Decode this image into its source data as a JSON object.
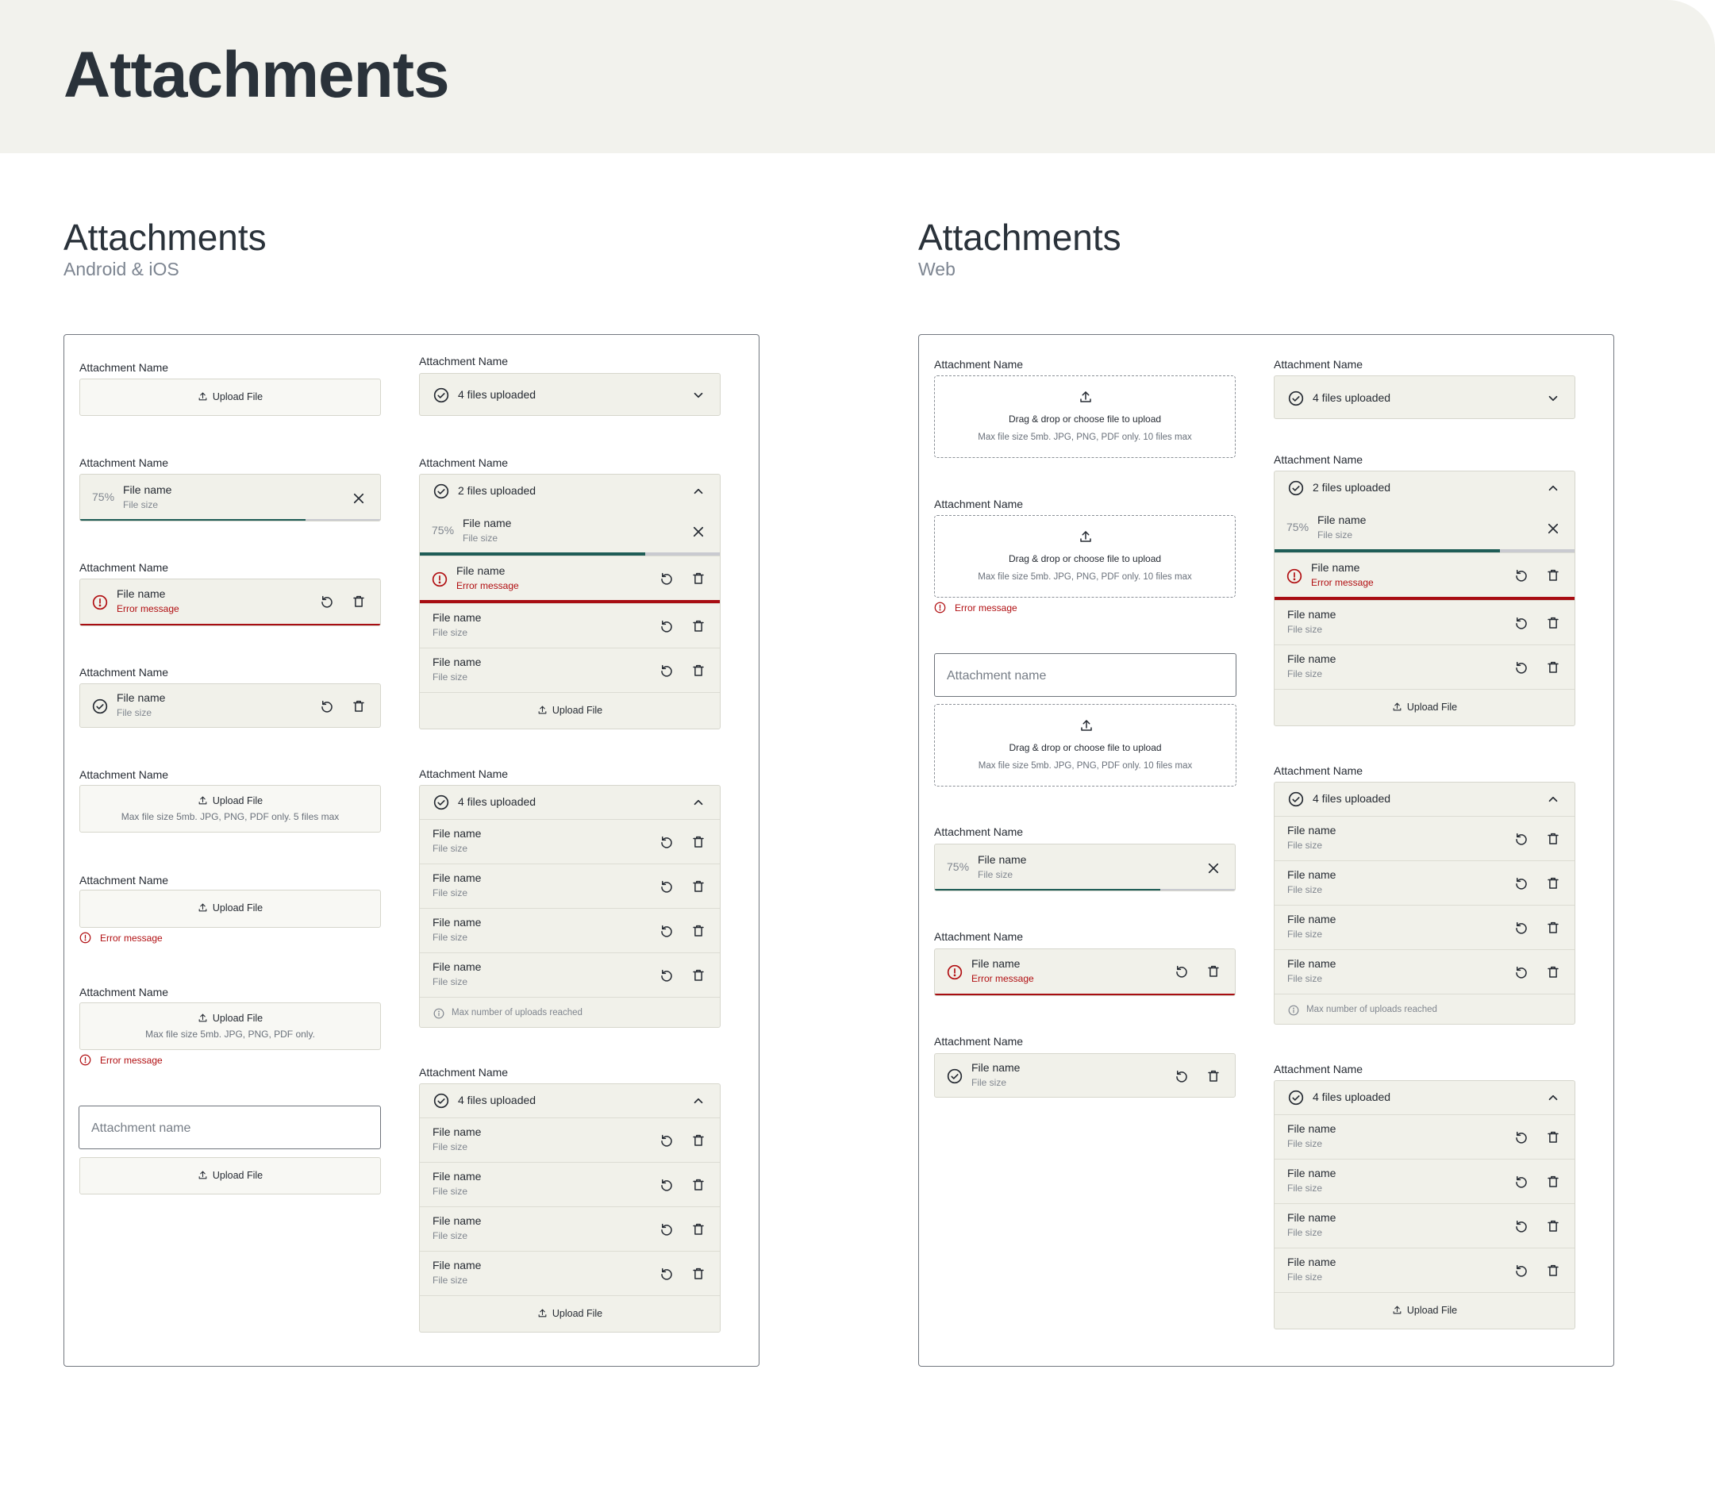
{
  "page": {
    "title": "Attachments"
  },
  "sections": {
    "mobile": {
      "title": "Attachments",
      "subtitle": "Android & iOS"
    },
    "web": {
      "title": "Attachments",
      "subtitle": "Web"
    }
  },
  "common": {
    "label": "Attachment Name",
    "upload": "Upload File",
    "file_name": "File name",
    "file_size": "File size",
    "error": "Error message",
    "progress": "75%",
    "progress_fraction": 0.75,
    "drag": "Drag & drop or choose file to upload",
    "drag_hint": "Max file size 5mb. JPG, PNG, PDF only. 10 files max",
    "hint_5": "Max file size 5mb. JPG, PNG, PDF only. 5 files max",
    "hint_plain": "Max file size 5mb. JPG, PNG, PDF only.",
    "name_placeholder": "Attachment name",
    "four_files": "4 files uploaded",
    "two_files": "2 files uploaded",
    "max_reached": "Max number of uploads reached"
  },
  "colors": {
    "accent": "#1f5d57",
    "error": "#a80d12",
    "surface": "#f1f1ea",
    "header": "#f2f2ed"
  },
  "icons": [
    "upload-icon",
    "check-circle-icon",
    "chevron-down-icon",
    "chevron-up-icon",
    "close-icon",
    "error-icon",
    "retry-icon",
    "trash-icon",
    "info-icon"
  ]
}
